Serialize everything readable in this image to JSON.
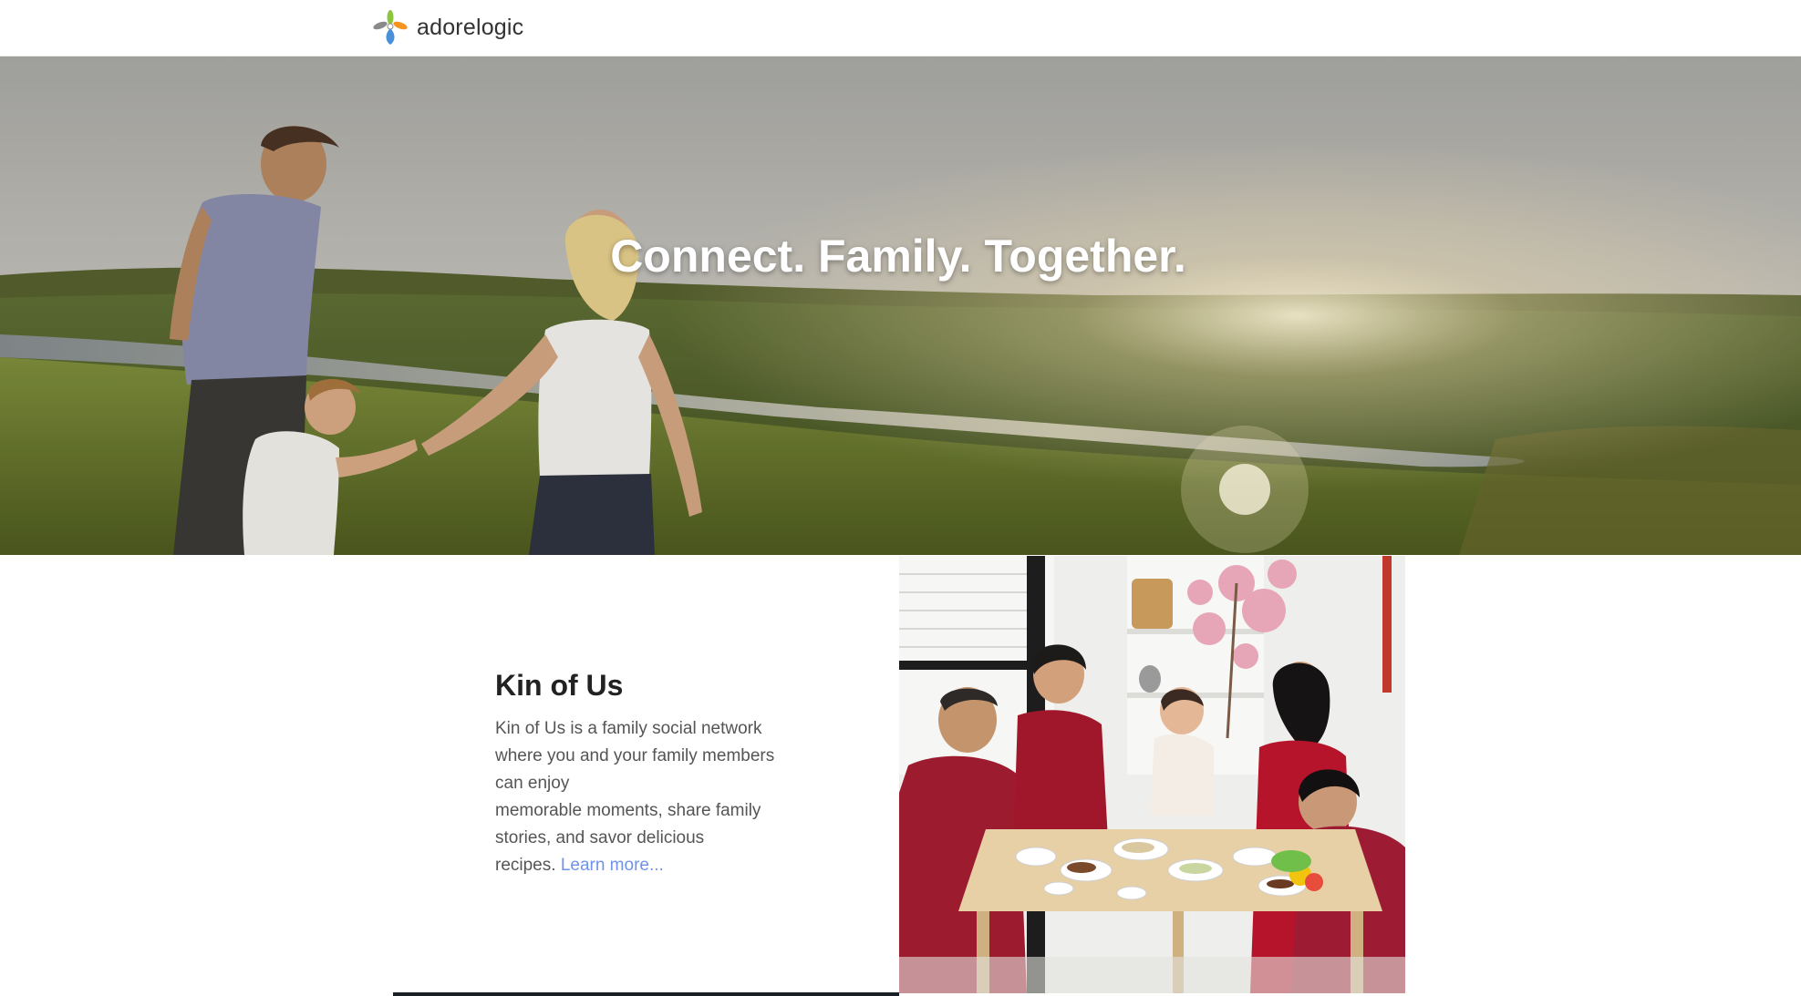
{
  "header": {
    "brand": "adorelogic",
    "logo_icon": "adorelogic-logo-icon",
    "colors": {
      "logo_green": "#8cc63f",
      "logo_orange": "#f7941d",
      "logo_blue": "#4a90d9",
      "logo_gray": "#8a8a8a"
    }
  },
  "hero": {
    "title": "Connect. Family. Together.",
    "image": "family-walking-meadow-sunset-photo"
  },
  "intro": {
    "heading": "Kin of Us",
    "body_lines": [
      "Kin of Us is a family social network",
      "where you and your family members",
      "can enjoy",
      "memorable moments, share family",
      "stories, and savor delicious",
      "recipes."
    ],
    "learn_more": "Learn more...",
    "link_color": "#6f93e8",
    "photo": "family-dinner-table-photo"
  }
}
